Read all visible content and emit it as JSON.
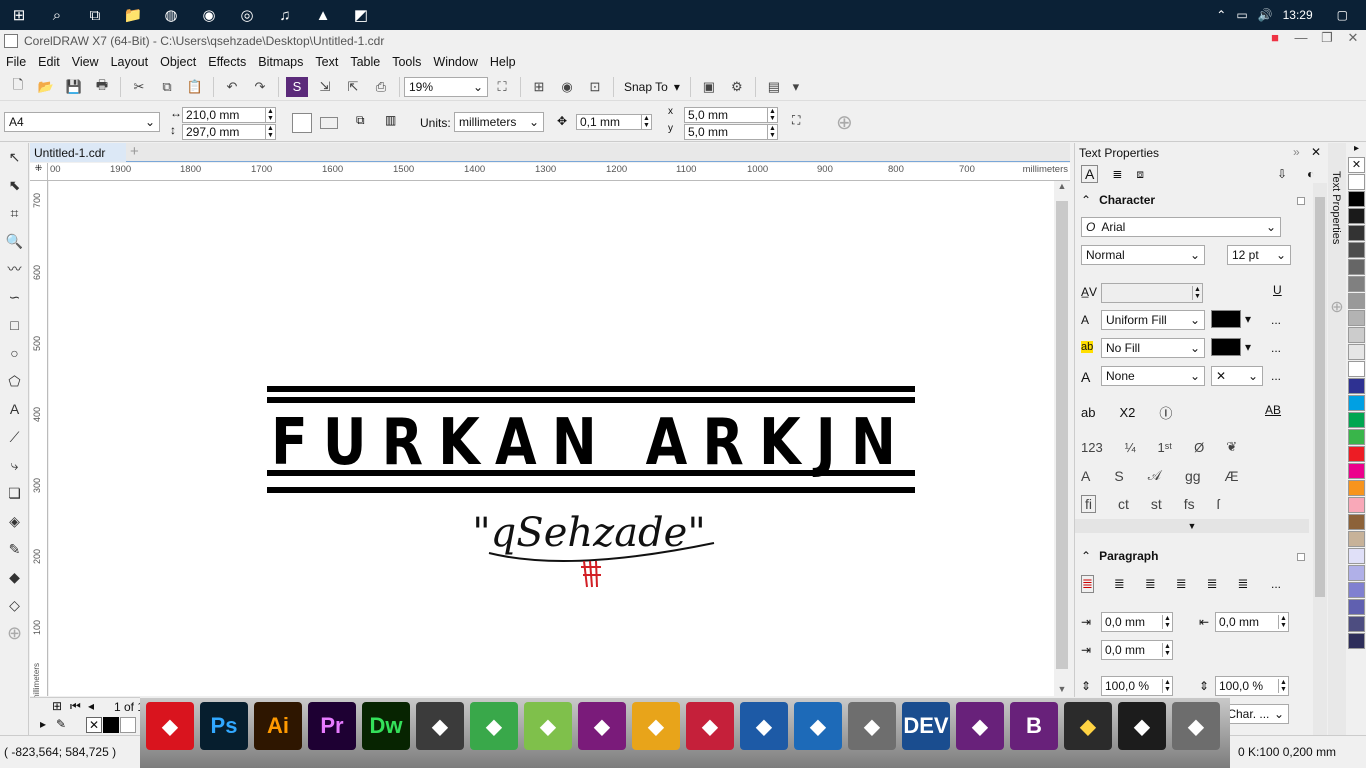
{
  "taskbar": {
    "clock": "13:29",
    "icons": [
      "windows-icon",
      "search-icon",
      "task-view-icon",
      "file-explorer-icon",
      "steam-icon",
      "firefox-icon",
      "chrome-icon",
      "itunes-icon",
      "vlc-icon",
      "coreldraw-icon"
    ]
  },
  "window": {
    "title": "CorelDRAW X7 (64-Bit) - C:\\Users\\qsehzade\\Desktop\\Untitled-1.cdr"
  },
  "menu": [
    "File",
    "Edit",
    "View",
    "Layout",
    "Object",
    "Effects",
    "Bitmaps",
    "Text",
    "Table",
    "Tools",
    "Window",
    "Help"
  ],
  "toolbar": {
    "zoom": "19%",
    "snap_to": "Snap To"
  },
  "propbar": {
    "page_size": "A4",
    "width": "210,0 mm",
    "height": "297,0 mm",
    "units_label": "Units:",
    "units": "millimeters",
    "nudge": "0,1 mm",
    "dup_x": "5,0 mm",
    "dup_y": "5,0 mm"
  },
  "document": {
    "tab": "Untitled-1.cdr",
    "ruler_h": [
      "00",
      "1900",
      "1800",
      "1700",
      "1600",
      "1500",
      "1400",
      "1300",
      "1200",
      "1100",
      "1000",
      "900",
      "800",
      "700"
    ],
    "ruler_h_unit": "millimeters",
    "ruler_v": [
      "700",
      "600",
      "500",
      "400",
      "300",
      "200",
      "100"
    ],
    "ruler_v_unit": "millimeters",
    "logo_text": "FURKAN ARKJN",
    "signature": "\"qSehzade\""
  },
  "pagenav": {
    "page": "1 of 1"
  },
  "docker": {
    "title": "Text Properties",
    "side_tab": "Text Properties",
    "character": {
      "header": "Character",
      "font": "Arial",
      "style": "Normal",
      "size": "12 pt",
      "fill_type": "Uniform Fill",
      "bg_fill": "No Fill",
      "outline": "None",
      "more": "...",
      "superscript_label": "X2"
    },
    "paragraph": {
      "header": "Paragraph",
      "left_indent": "0,0 mm",
      "right_indent": "0,0 mm",
      "first_indent": "0,0 mm",
      "line_spacing": "100,0 %",
      "char_spacing": "100,0 %",
      "spacing_unit": "% of Char. ..."
    }
  },
  "status": {
    "coords": "( -823,564; 584,725 )",
    "right": "0 K:100  0,200 mm"
  },
  "dock": {
    "apps": [
      {
        "name": "creative-cloud",
        "label": "",
        "bg": "#d9141e",
        "fg": "#fff"
      },
      {
        "name": "photoshop",
        "label": "Ps",
        "bg": "#061e2e",
        "fg": "#31a8ff"
      },
      {
        "name": "illustrator",
        "label": "Ai",
        "bg": "#2e1600",
        "fg": "#ff9a00"
      },
      {
        "name": "premiere",
        "label": "Pr",
        "bg": "#1e0033",
        "fg": "#e77bff"
      },
      {
        "name": "dreamweaver",
        "label": "Dw",
        "bg": "#072401",
        "fg": "#34e05a"
      },
      {
        "name": "coreldraw",
        "label": "",
        "bg": "#3b3b3b",
        "fg": "#fff"
      },
      {
        "name": "corel-paint",
        "label": "",
        "bg": "#39a84a",
        "fg": "#fff"
      },
      {
        "name": "corel-painter",
        "label": "",
        "bg": "#7fc04b",
        "fg": "#fff"
      },
      {
        "name": "corel-connect",
        "label": "",
        "bg": "#7a1b7a",
        "fg": "#fff"
      },
      {
        "name": "corel-capture",
        "label": "",
        "bg": "#e8a41a",
        "fg": "#fff"
      },
      {
        "name": "corel-video",
        "label": "",
        "bg": "#c5203a",
        "fg": "#fff"
      },
      {
        "name": "video-editor",
        "label": "",
        "bg": "#1d5aa6",
        "fg": "#fff"
      },
      {
        "name": "corel-update",
        "label": "",
        "bg": "#1d6ab8",
        "fg": "#fff"
      },
      {
        "name": "gimp",
        "label": "",
        "bg": "#6e6e6e",
        "fg": "#fff"
      },
      {
        "name": "dev-cpp",
        "label": "DEV",
        "bg": "#1a4d8f",
        "fg": "#fff"
      },
      {
        "name": "visual-studio",
        "label": "",
        "bg": "#68217a",
        "fg": "#fff"
      },
      {
        "name": "visual-basic",
        "label": "B",
        "bg": "#68217a",
        "fg": "#fff"
      },
      {
        "name": "python",
        "label": "",
        "bg": "#2b2b2b",
        "fg": "#ffd343"
      },
      {
        "name": "obs",
        "label": "",
        "bg": "#1c1c1c",
        "fg": "#fff"
      },
      {
        "name": "infinity",
        "label": "",
        "bg": "#6d6d6d",
        "fg": "#fff"
      }
    ]
  },
  "palette": [
    "#ffffff",
    "#000000",
    "#1a1a1a",
    "#333333",
    "#4d4d4d",
    "#666666",
    "#808080",
    "#999999",
    "#b3b3b3",
    "#cccccc",
    "#e6e6e6",
    "#ffffff",
    "#2e3192",
    "#00a0e3",
    "#00a651",
    "#39b54a",
    "#ed1c24",
    "#ec008c",
    "#f7941d",
    "#f9a8b8",
    "#8c6239",
    "#c7b299",
    "#e0e0f8",
    "#b0b0e8",
    "#8080d0",
    "#6060b0",
    "#4d4d80",
    "#2e2e5a"
  ]
}
